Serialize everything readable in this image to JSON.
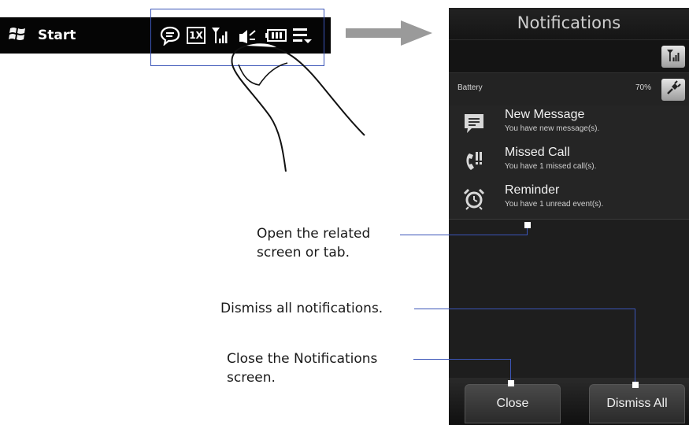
{
  "taskbar": {
    "start_label": "Start",
    "icons": [
      "message-bubble-icon",
      "1x-data-icon",
      "signal-strength-icon",
      "speaker-volume-icon",
      "battery-icon",
      "menu-dropdown-icon"
    ],
    "one_x_label": "1X"
  },
  "notifications": {
    "title": "Notifications",
    "battery_label": "Battery",
    "battery_value": "70%",
    "items": [
      {
        "title": "New Message",
        "subtitle": "You have new message(s).",
        "icon": "message-icon"
      },
      {
        "title": "Missed Call",
        "subtitle": "You have 1 missed call(s).",
        "icon": "missed-call-icon"
      },
      {
        "title": "Reminder",
        "subtitle": "You have 1 unread event(s).",
        "icon": "alarm-clock-icon"
      }
    ],
    "close_label": "Close",
    "dismiss_all_label": "Dismiss All"
  },
  "callouts": {
    "open_related_line1": "Open the related",
    "open_related_line2": "screen or tab.",
    "dismiss_all": "Dismiss all notifications.",
    "close_line1": "Close the Notifications",
    "close_line2": "screen."
  },
  "colors": {
    "callout_line": "#3b55b8",
    "phone_bg": "#1b1b1b",
    "taskbar_bg": "#050505"
  }
}
